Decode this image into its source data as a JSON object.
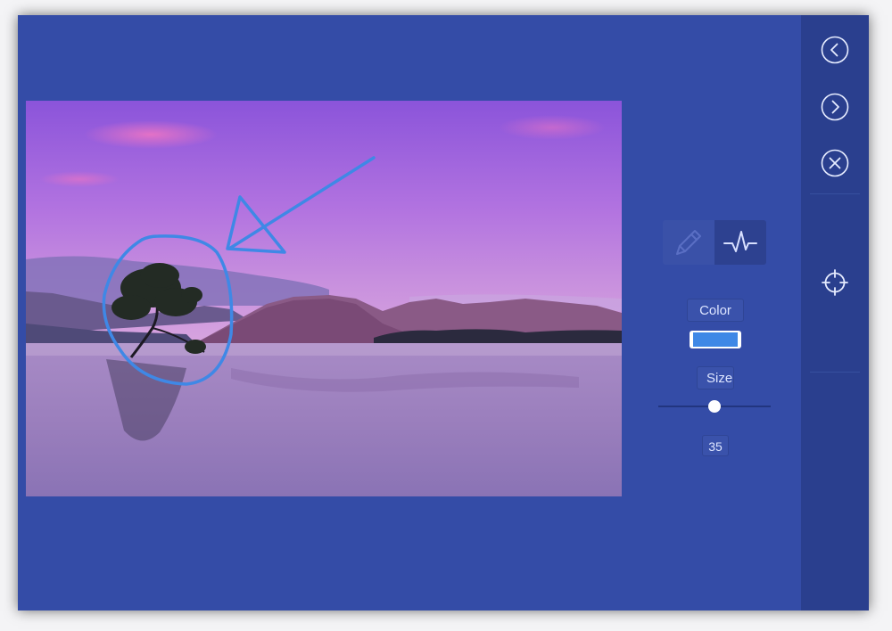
{
  "canvas": {
    "image": "lake-tree-sunset-photo",
    "annotations": [
      {
        "type": "arrow",
        "color": "#3f88e6"
      },
      {
        "type": "ellipse",
        "color": "#3f88e6"
      }
    ]
  },
  "tools": {
    "pencil": {
      "icon": "pencil-icon",
      "active": false
    },
    "line": {
      "icon": "pulse-line-icon",
      "active": true
    }
  },
  "color": {
    "label": "Color",
    "value": "#3f88e6"
  },
  "size": {
    "label": "Size",
    "value": "35",
    "level_percent": 50
  },
  "sidebar": {
    "back": {
      "icon": "chevron-left-circle-icon"
    },
    "forward": {
      "icon": "chevron-right-circle-icon"
    },
    "close": {
      "icon": "close-circle-icon"
    },
    "target": {
      "icon": "crosshair-icon"
    }
  },
  "colors": {
    "background": "#344ca7",
    "sidebar": "#2a3f8e",
    "accent": "#3f88e6"
  }
}
